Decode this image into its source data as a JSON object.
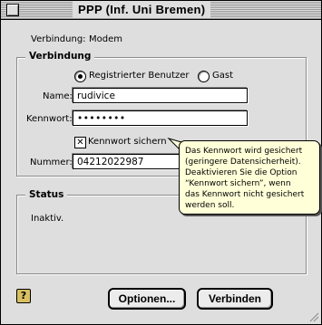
{
  "window": {
    "title": "PPP (Inf. Uni Bremen)"
  },
  "connection": {
    "label": "Verbindung:",
    "value": "Modem"
  },
  "verbindung_group": {
    "title": "Verbindung",
    "radio_registered": "Registrierter Benutzer",
    "radio_guest": "Gast",
    "selected": "Registrierter Benutzer",
    "name_label": "Name:",
    "name_value": "rudivice",
    "password_label": "Kennwort:",
    "password_value": "••••••••",
    "save_password_label": "Kennwort sichern",
    "save_password_checked": true,
    "number_label": "Nummer:",
    "number_value": "04212022987"
  },
  "status_group": {
    "title": "Status",
    "text": "Inaktiv."
  },
  "help": {
    "icon": "help-icon",
    "text": "Das Kennwort wird gesichert\n(geringere Datensicherheit).\nDeaktivieren Sie die Option\n“Kennwort sichern”, wenn\ndas Kennwort nicht gesichert\nwerden soll."
  },
  "buttons": {
    "options": "Optionen...",
    "connect": "Verbinden"
  }
}
